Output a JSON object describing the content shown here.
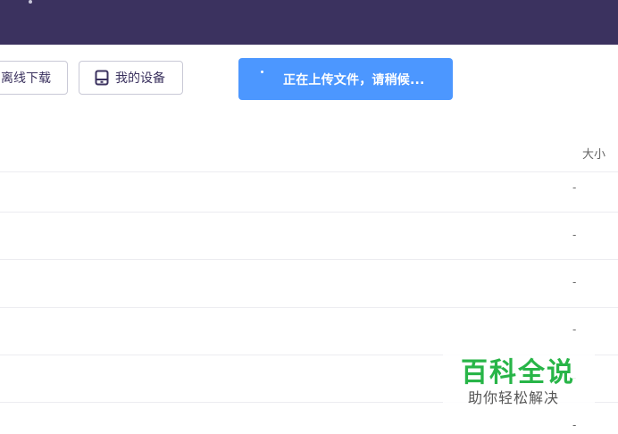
{
  "toolbar": {
    "offline_download_label": "离线下载",
    "my_devices_label": "我的设备"
  },
  "toast": {
    "message": "正在上传文件，请稍候..."
  },
  "table": {
    "size_header": "大小",
    "rows": [
      {
        "size": "-"
      },
      {
        "size": "-"
      },
      {
        "size": "-"
      },
      {
        "size": "-"
      },
      {
        "size": "-"
      },
      {
        "size": "-"
      }
    ]
  },
  "watermark": {
    "title": "百科全说",
    "subtitle": "助你轻松解决"
  },
  "colors": {
    "header_bg": "#3b325f",
    "toast_bg": "#4c97ff",
    "watermark_green": "#28b548"
  },
  "icons": {
    "devices": "tablet-device-icon",
    "loading": "spinner-icon"
  }
}
